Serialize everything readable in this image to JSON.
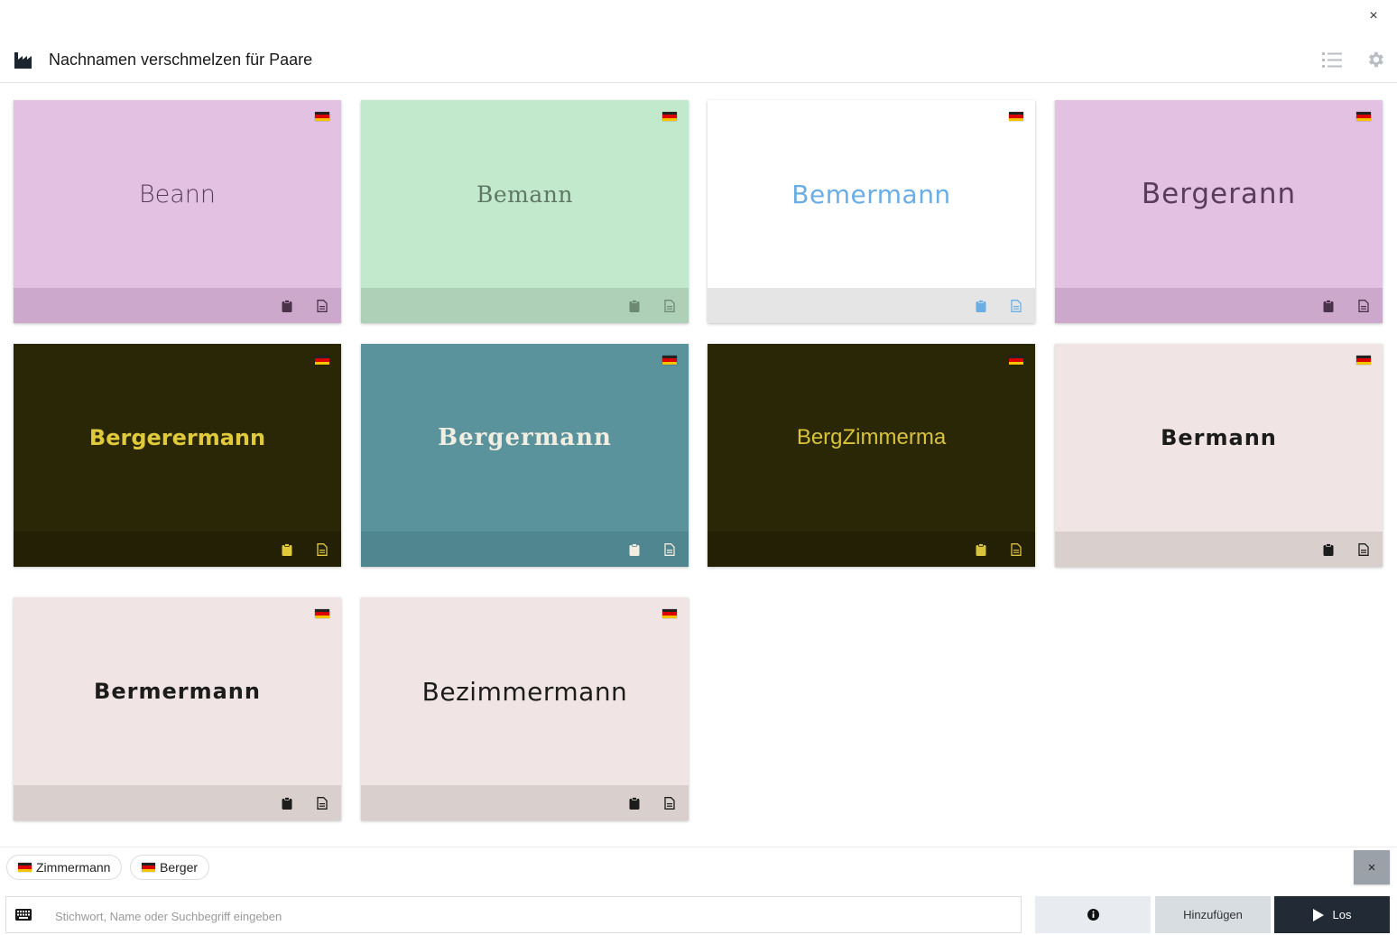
{
  "window": {
    "close_label": "×"
  },
  "header": {
    "title": "Nachnamen verschmelzen für Paare",
    "logo_icon": "factory-icon",
    "list_icon": "list-icon",
    "settings_icon": "gear-icon"
  },
  "cards": [
    {
      "name": "Beann",
      "bg": "#e2c1e3",
      "footer": "#cca8cd",
      "color": "#5a3d5c",
      "icon_color": "#4a324b",
      "font": "\"DejaVu Sans\", sans-serif",
      "weight": "200",
      "size": "27px",
      "spacing": "0px"
    },
    {
      "name": "Bemann",
      "bg": "#c3e9cd",
      "footer": "#aed0b6",
      "color": "#5f7866",
      "icon_color": "#6e8a74",
      "font": "\"DejaVu Serif\", serif",
      "weight": "400",
      "size": "25px",
      "spacing": "0.5px"
    },
    {
      "name": "Bemermann",
      "bg": "#ffffff",
      "footer": "#e5e5e5",
      "color": "#6aaee5",
      "icon_color": "#6aaee5",
      "font": "\"DejaVu Sans\", sans-serif",
      "weight": "400",
      "size": "28px",
      "spacing": "0.5px"
    },
    {
      "name": "Bergerann",
      "bg": "#e2c1e3",
      "footer": "#cca8cd",
      "color": "#5a3d5c",
      "icon_color": "#4a324b",
      "font": "\"DejaVu Sans\", sans-serif",
      "weight": "400",
      "size": "31px",
      "spacing": "1px"
    },
    {
      "name": "Bergerermann",
      "bg": "#2a2706",
      "footer": "#232005",
      "color": "#e0c93a",
      "icon_color": "#e0c93a",
      "font": "\"DejaVu Sans\", sans-serif",
      "weight": "700",
      "size": "24px",
      "spacing": "0px"
    },
    {
      "name": "Bergermann",
      "bg": "#5a939c",
      "footer": "#4f868f",
      "color": "#f1ede0",
      "icon_color": "#f1ede0",
      "font": "\"DejaVu Serif\", serif",
      "weight": "700",
      "size": "26px",
      "spacing": "1px"
    },
    {
      "name": "BergZimmerma",
      "bg": "#2a2706",
      "footer": "#232005",
      "color": "#d9c23c",
      "icon_color": "#d9c23c",
      "font": "\"Liberation Sans\", sans-serif",
      "weight": "400",
      "size": "24px",
      "spacing": "0px"
    },
    {
      "name": "Bermann",
      "bg": "#f0e5e4",
      "footer": "#d9cfcd",
      "color": "#1c1c1c",
      "icon_color": "#1c1c1c",
      "font": "\"DejaVu Sans\", sans-serif",
      "weight": "700",
      "size": "24px",
      "spacing": "1px"
    },
    {
      "name": "Bermermann",
      "bg": "#f0e5e4",
      "footer": "#d9cfcd",
      "color": "#1c1c1c",
      "icon_color": "#1c1c1c",
      "font": "\"DejaVu Sans\", sans-serif",
      "weight": "700",
      "size": "24px",
      "spacing": "1px"
    },
    {
      "name": "Bezimmermann",
      "bg": "#f0e5e4",
      "footer": "#d9cfcd",
      "color": "#1c1c1c",
      "icon_color": "#1c1c1c",
      "font": "\"DejaVu Sans\", sans-serif",
      "weight": "400",
      "size": "28px",
      "spacing": "0.5px"
    }
  ],
  "chips": [
    {
      "label": "Zimmermann"
    },
    {
      "label": "Berger"
    }
  ],
  "chips_clear_label": "×",
  "search": {
    "placeholder": "Stichwort, Name oder Suchbegriff eingeben",
    "value": ""
  },
  "buttons": {
    "add_label": "Hinzufügen",
    "go_label": "Los"
  },
  "colors": {
    "go_bg": "#222a35",
    "flag_black": "#222222",
    "flag_red": "#dd0000",
    "flag_gold": "#f5c400"
  }
}
